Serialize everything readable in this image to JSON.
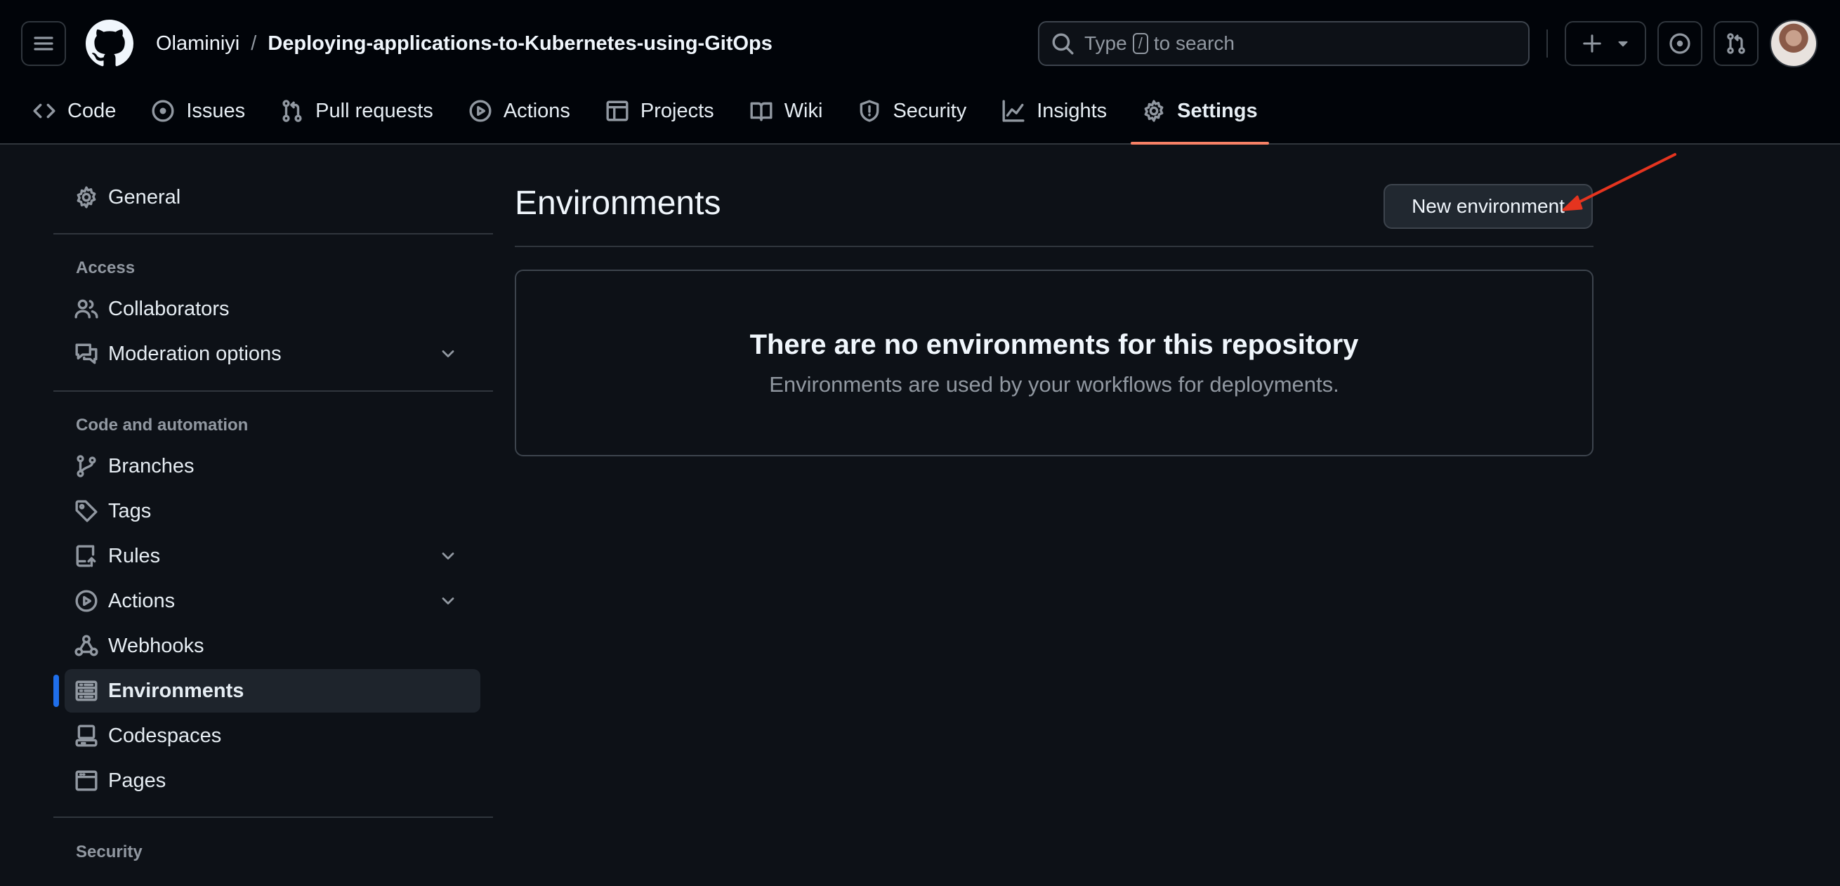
{
  "header": {
    "owner": "Olaminiyi",
    "separator": "/",
    "repo": "Deploying-applications-to-Kubernetes-using-GitOps",
    "search": {
      "prefix": "Type",
      "key": "/",
      "suffix": "to search"
    }
  },
  "tabs": [
    {
      "label": "Code",
      "icon": "code-icon"
    },
    {
      "label": "Issues",
      "icon": "issue-opened-icon"
    },
    {
      "label": "Pull requests",
      "icon": "git-pull-request-icon"
    },
    {
      "label": "Actions",
      "icon": "play-icon"
    },
    {
      "label": "Projects",
      "icon": "table-icon"
    },
    {
      "label": "Wiki",
      "icon": "book-icon"
    },
    {
      "label": "Security",
      "icon": "shield-icon"
    },
    {
      "label": "Insights",
      "icon": "graph-icon"
    },
    {
      "label": "Settings",
      "icon": "gear-icon",
      "active": true
    }
  ],
  "sidebar": {
    "general": "General",
    "access_heading": "Access",
    "collaborators": "Collaborators",
    "moderation": "Moderation options",
    "code_heading": "Code and automation",
    "branches": "Branches",
    "tags": "Tags",
    "rules": "Rules",
    "actions": "Actions",
    "webhooks": "Webhooks",
    "environments": "Environments",
    "codespaces": "Codespaces",
    "pages": "Pages",
    "security_heading": "Security"
  },
  "main": {
    "title": "Environments",
    "new_button": "New environment",
    "empty_title": "There are no environments for this repository",
    "empty_desc": "Environments are used by your workflows for deployments."
  },
  "colors": {
    "background": "#0d1117",
    "header_bg": "#010409",
    "active_tab_underline": "#f78166",
    "active_sidebar_bar": "#1f6feb",
    "annotation_arrow": "#e5341f"
  }
}
